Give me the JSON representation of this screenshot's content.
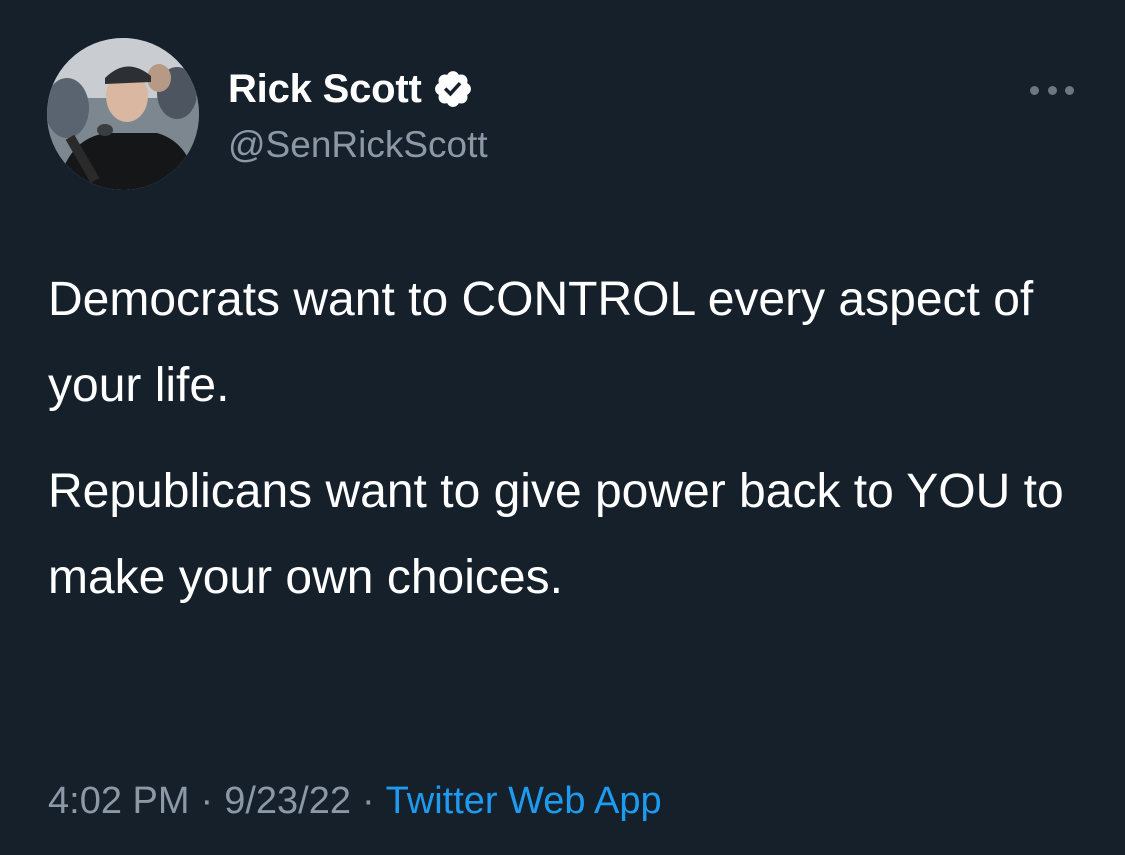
{
  "tweet": {
    "author": {
      "display_name": "Rick Scott",
      "handle": "@SenRickScott",
      "verified": true,
      "avatar_icon": "profile-photo"
    },
    "more_icon": "more-dots-icon",
    "text": {
      "paragraph_1": "Democrats want to CONTROL every aspect of your life.",
      "paragraph_2": "Republicans want to give power back to YOU to make your own choices."
    },
    "meta": {
      "time": "4:02 PM",
      "separator": "·",
      "date": "9/23/22",
      "source": "Twitter Web App"
    }
  },
  "colors": {
    "background": "#15202b",
    "text_primary": "#ffffff",
    "text_secondary": "#8b98a5",
    "accent": "#1d9bf0"
  }
}
